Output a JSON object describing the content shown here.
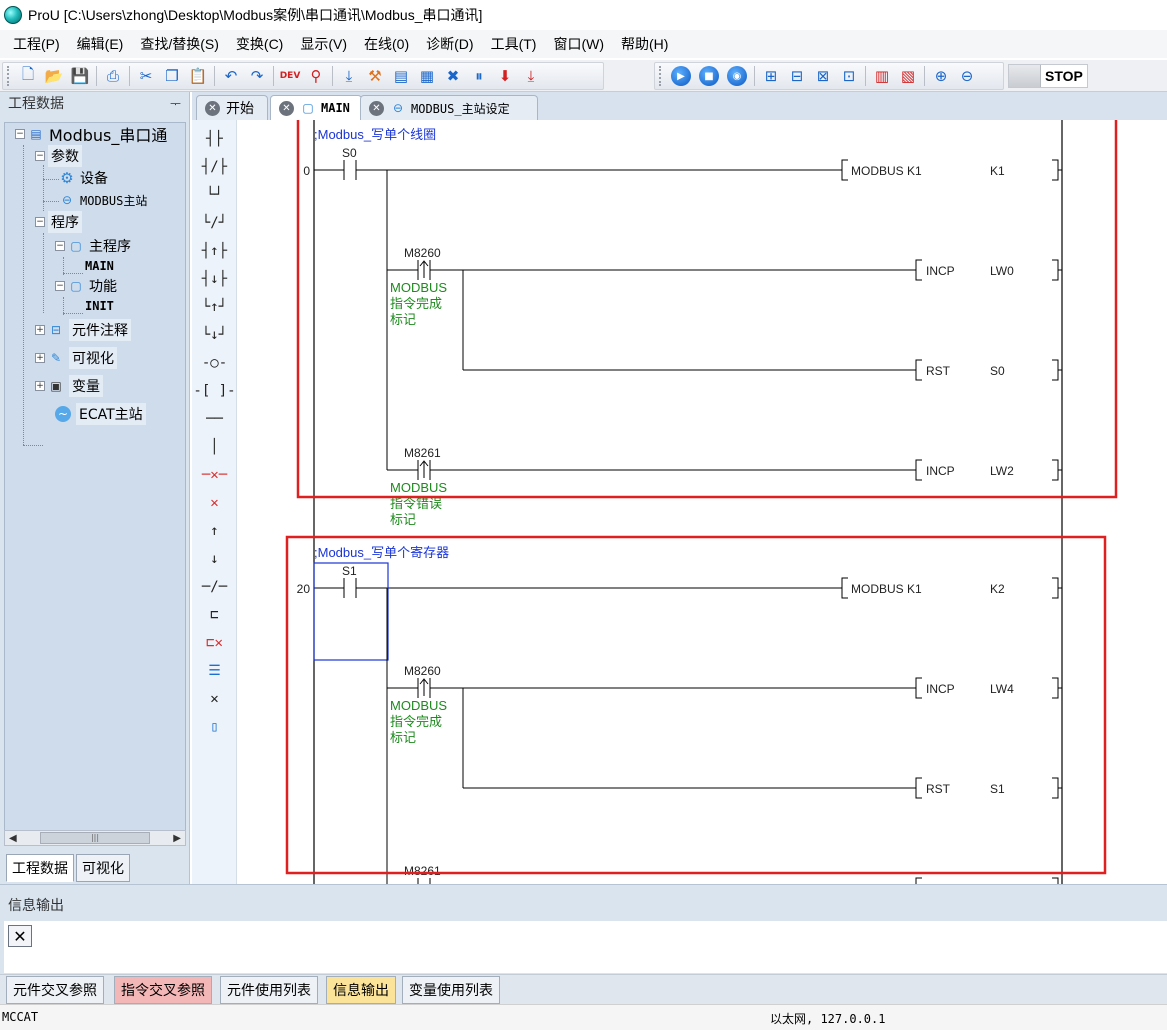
{
  "window": {
    "title": "ProU [C:\\Users\\zhong\\Desktop\\Modbus案例\\串口通讯\\Modbus_串口通讯]"
  },
  "menu": [
    "工程(P)",
    "编辑(E)",
    "查找/替换(S)",
    "变换(C)",
    "显示(V)",
    "在线(0)",
    "诊断(D)",
    "工具(T)",
    "窗口(W)",
    "帮助(H)"
  ],
  "toolbar": {
    "plc_state": "STOP",
    "dev_label": "DEV"
  },
  "left_panel": {
    "title": "工程数据",
    "pin": "ᅮ",
    "tree": {
      "root": "Modbus_串口通",
      "params": "参数",
      "device": "设备",
      "modbus_master": "MODBUS主站",
      "program": "程序",
      "main_program": "主程序",
      "main": "MAIN",
      "function": "功能",
      "init": "INIT",
      "element_comment": "元件注释",
      "visualization": "可视化",
      "variables": "变量",
      "ecat_master": "ECAT主站"
    },
    "scroll_thumb": "|||",
    "tabs": [
      "工程数据",
      "可视化"
    ]
  },
  "doc_tabs": [
    {
      "label": "开始"
    },
    {
      "label": "MAIN"
    },
    {
      "label": "MODBUS_主站设定"
    }
  ],
  "ladder": {
    "rung1": {
      "comment": ";Modbus_写单个线圈",
      "step": "0",
      "contact": "S0",
      "coil": "MODBUS K1",
      "coil_arg": "K1",
      "pulse1": "M8260",
      "pulse1_comment": [
        "MODBUS",
        "指令完成",
        "标记"
      ],
      "incp1": "INCP",
      "incp1_arg": "LW0",
      "rst": "RST",
      "rst_arg": "S0",
      "pulse2": "M8261",
      "pulse2_comment": [
        "MODBUS",
        "指令错误",
        "标记"
      ],
      "incp2": "INCP",
      "incp2_arg": "LW2"
    },
    "rung2": {
      "comment": ";Modbus_写单个寄存器",
      "step": "20",
      "contact": "S1",
      "coil": "MODBUS K1",
      "coil_arg": "K2",
      "pulse1": "M8260",
      "pulse1_comment": [
        "MODBUS",
        "指令完成",
        "标记"
      ],
      "incp1": "INCP",
      "incp1_arg": "LW4",
      "rst": "RST",
      "rst_arg": "S1",
      "pulse2": "M8261"
    }
  },
  "info_panel": {
    "title": "信息输出",
    "clear": "✕"
  },
  "bottom_tabs": [
    {
      "label": "元件交叉参照",
      "state": "normal"
    },
    {
      "label": "指令交叉参照",
      "state": "highlight-red"
    },
    {
      "label": "元件使用列表",
      "state": "normal"
    },
    {
      "label": "信息输出",
      "state": "highlight-yellow"
    },
    {
      "label": "变量使用列表",
      "state": "normal"
    }
  ],
  "status": {
    "left": "MCCAT",
    "connection": "以太网, 127.0.0.1"
  },
  "colors": {
    "annotation_box": "#e02020",
    "comment_text": "#1a35d6",
    "device_comment": "#1e8a1e",
    "selection": "#1a35d6"
  }
}
